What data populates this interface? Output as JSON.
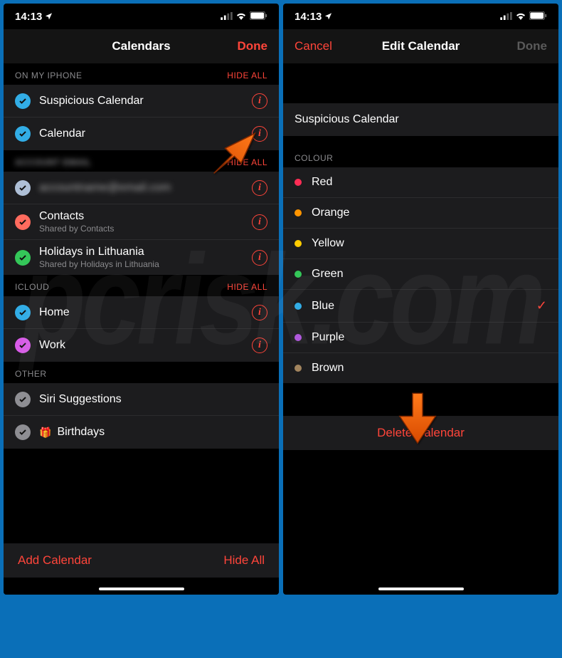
{
  "status": {
    "time": "14:13"
  },
  "left": {
    "nav": {
      "title": "Calendars",
      "done": "Done"
    },
    "sections": [
      {
        "name": "ON MY IPHONE",
        "hide": "HIDE ALL",
        "items": [
          {
            "label": "Suspicious Calendar",
            "color": "#32ade6"
          },
          {
            "label": "Calendar",
            "color": "#32ade6"
          }
        ]
      },
      {
        "name": "ACCOUNT EMAIL",
        "hide": "HIDE ALL",
        "blurred": true,
        "items": [
          {
            "label": "accountname@email.com",
            "color": "#aebfd6",
            "blurred": true
          },
          {
            "label": "Contacts",
            "sub": "Shared by Contacts",
            "color": "#ff6b5e"
          },
          {
            "label": "Holidays in Lithuania",
            "sub": "Shared by Holidays in Lithuania",
            "color": "#34c759"
          }
        ]
      },
      {
        "name": "ICLOUD",
        "hide": "HIDE ALL",
        "items": [
          {
            "label": "Home",
            "color": "#32ade6"
          },
          {
            "label": "Work",
            "color": "#d85be8"
          }
        ]
      },
      {
        "name": "OTHER",
        "items": [
          {
            "label": "Siri Suggestions",
            "color": "#8e8e93",
            "noinfo": true
          },
          {
            "label": "Birthdays",
            "color": "#8e8e93",
            "noinfo": true,
            "gift": true
          }
        ]
      }
    ],
    "footer": {
      "add": "Add Calendar",
      "hide": "Hide All"
    }
  },
  "right": {
    "nav": {
      "cancel": "Cancel",
      "title": "Edit Calendar",
      "done": "Done"
    },
    "name_field": "Suspicious Calendar",
    "colour_header": "COLOUR",
    "colours": [
      {
        "label": "Red",
        "hex": "#ff2d55"
      },
      {
        "label": "Orange",
        "hex": "#ff9500"
      },
      {
        "label": "Yellow",
        "hex": "#ffcc00"
      },
      {
        "label": "Green",
        "hex": "#34c759"
      },
      {
        "label": "Blue",
        "hex": "#32ade6",
        "selected": true
      },
      {
        "label": "Purple",
        "hex": "#af52de"
      },
      {
        "label": "Brown",
        "hex": "#a2845e"
      }
    ],
    "delete": "Delete Calendar"
  },
  "watermark": "pcrisk.com"
}
